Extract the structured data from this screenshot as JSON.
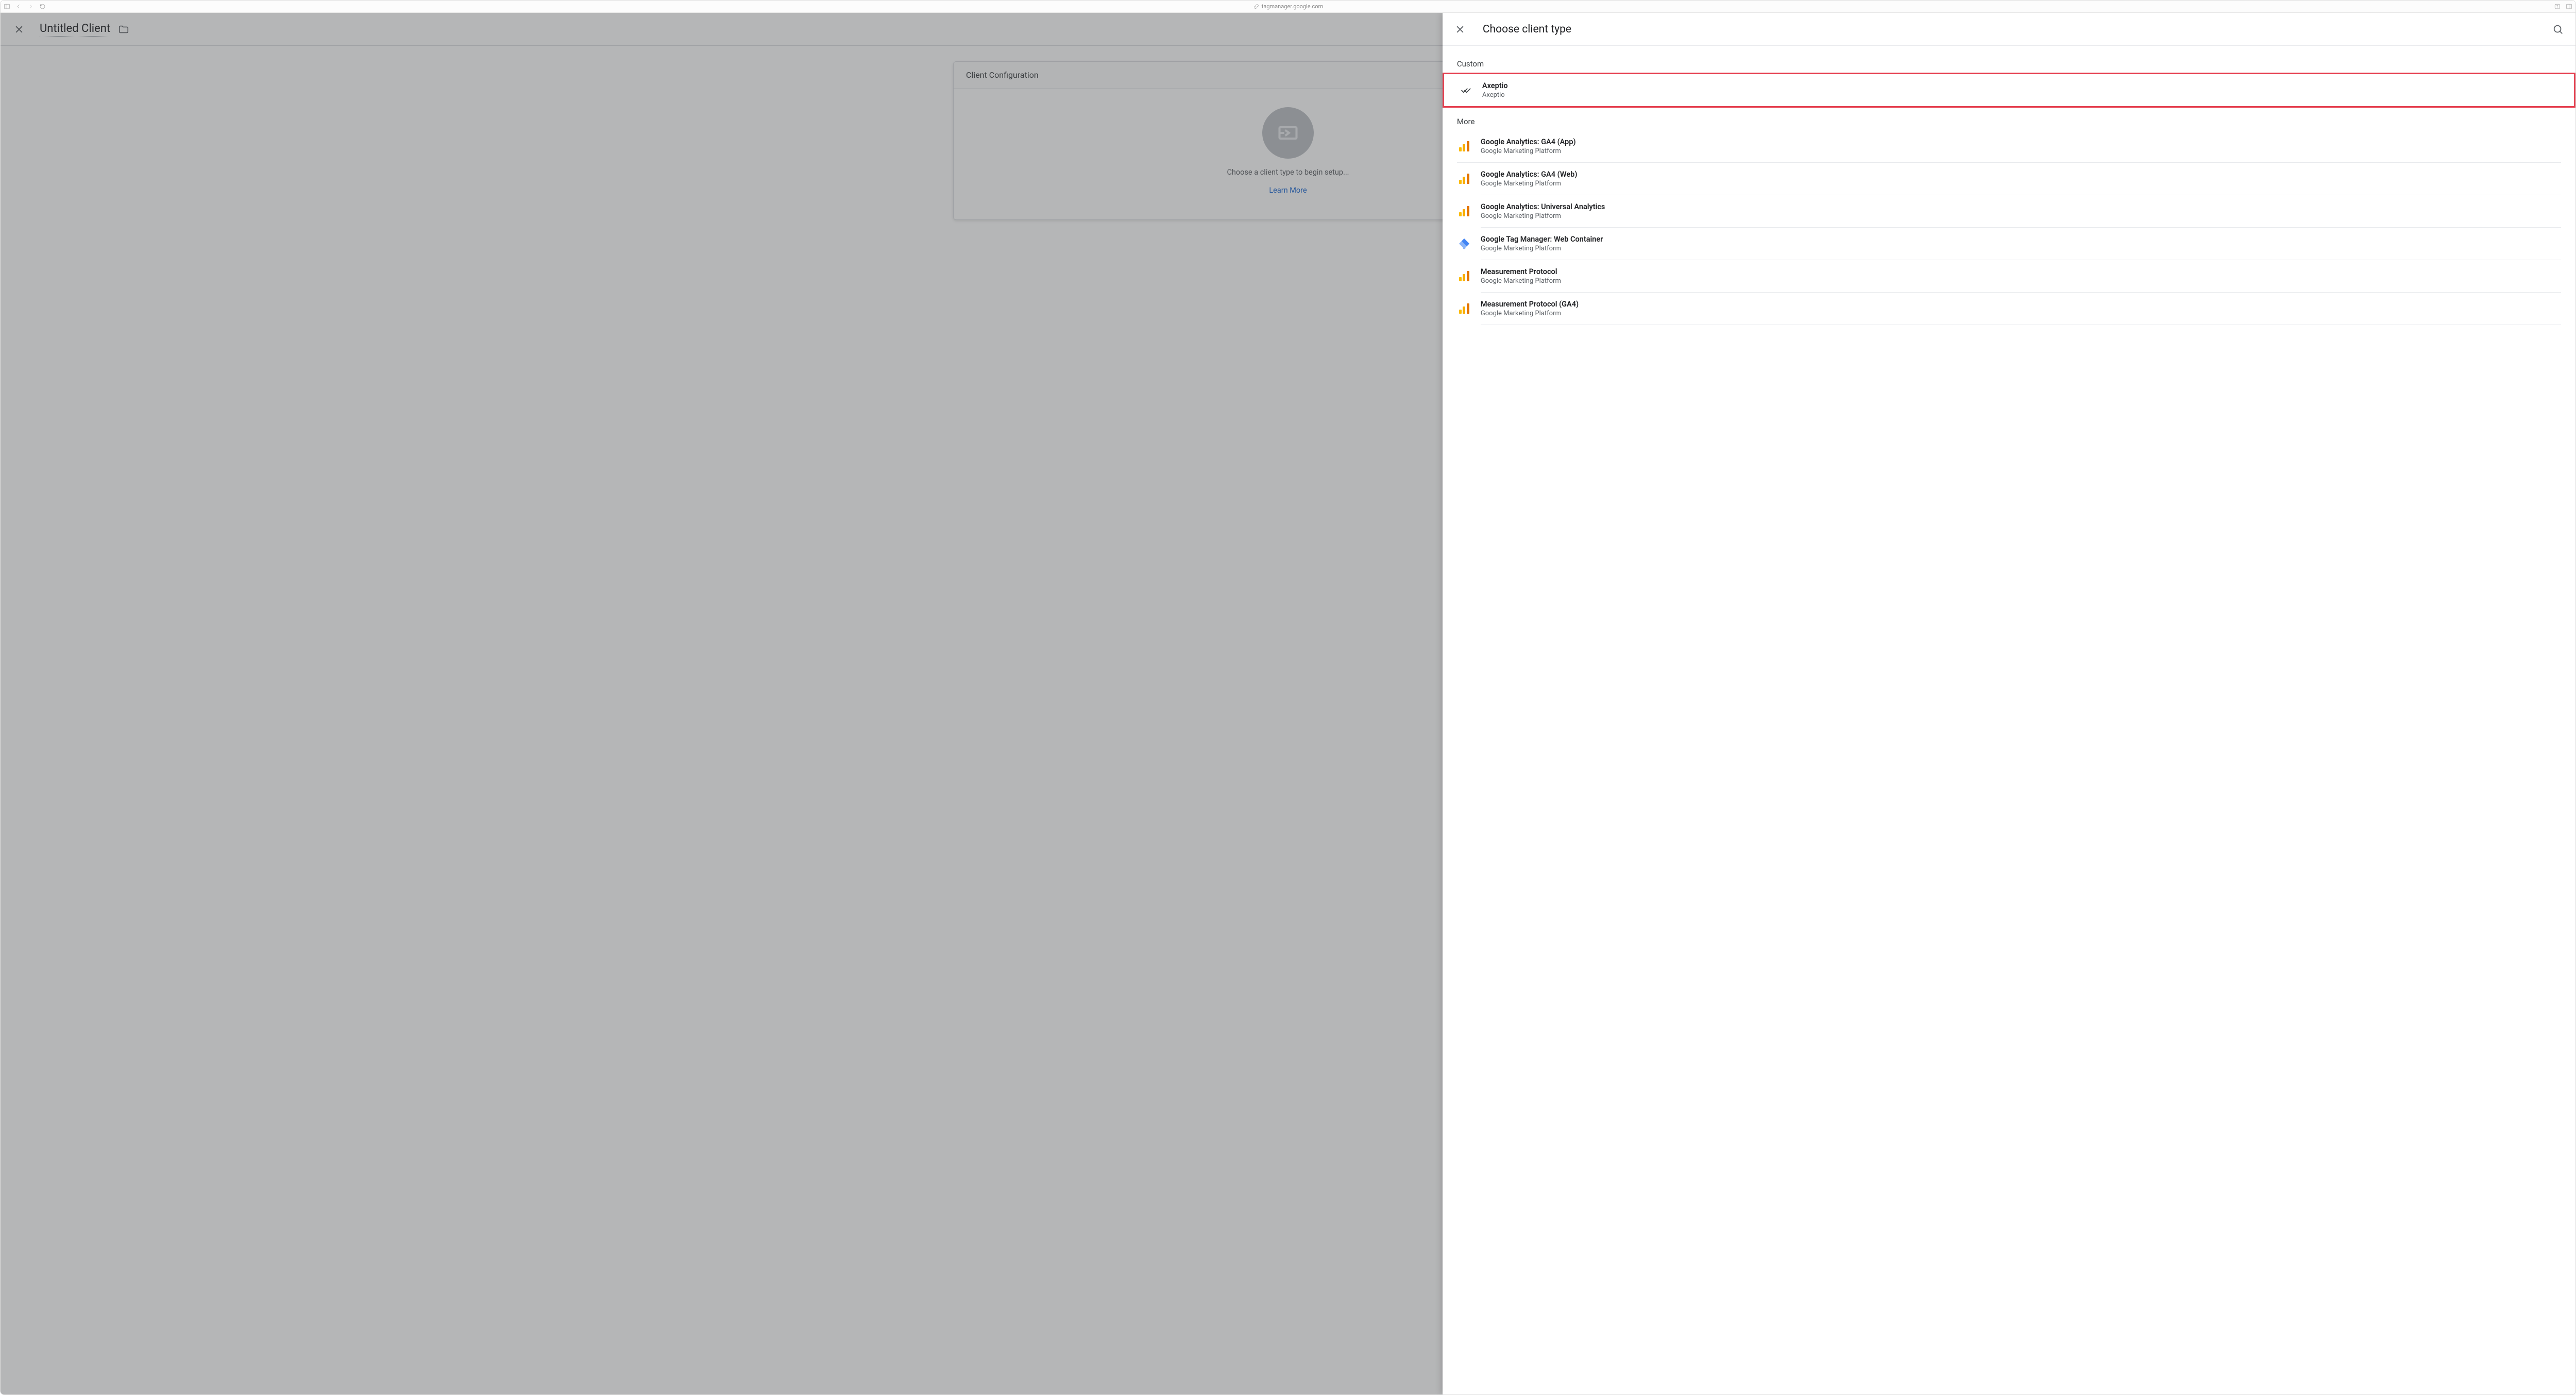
{
  "browser": {
    "url": "tagmanager.google.com"
  },
  "editor": {
    "title": "Untitled Client",
    "card_title": "Client Configuration",
    "prompt": "Choose a client type to begin setup...",
    "learn_more": "Learn More"
  },
  "panel": {
    "title": "Choose client type",
    "custom_label": "Custom",
    "more_label": "More",
    "custom": [
      {
        "name": "Axeptio",
        "sub": "Axeptio",
        "icon": "doublecheck"
      }
    ],
    "more": [
      {
        "name": "Google Analytics: GA4 (App)",
        "sub": "Google Marketing Platform",
        "icon": "ga"
      },
      {
        "name": "Google Analytics: GA4 (Web)",
        "sub": "Google Marketing Platform",
        "icon": "ga"
      },
      {
        "name": "Google Analytics: Universal Analytics",
        "sub": "Google Marketing Platform",
        "icon": "ga"
      },
      {
        "name": "Google Tag Manager: Web Container",
        "sub": "Google Marketing Platform",
        "icon": "gtm"
      },
      {
        "name": "Measurement Protocol",
        "sub": "Google Marketing Platform",
        "icon": "ga"
      },
      {
        "name": "Measurement Protocol (GA4)",
        "sub": "Google Marketing Platform",
        "icon": "ga"
      }
    ]
  }
}
